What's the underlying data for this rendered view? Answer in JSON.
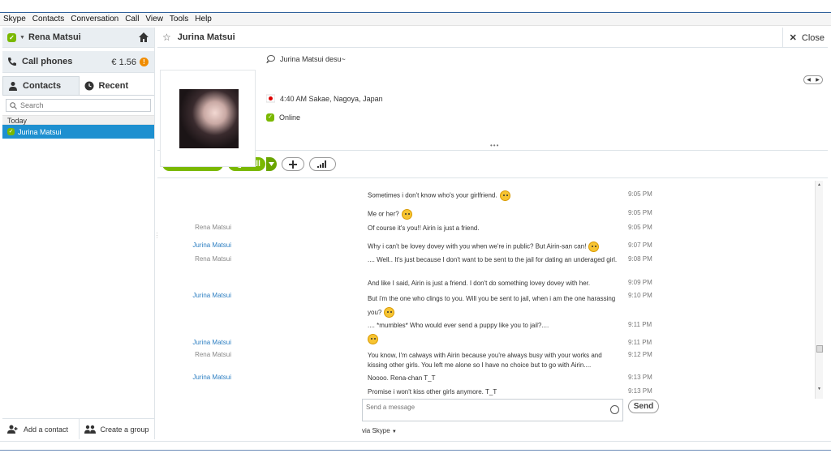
{
  "menu": [
    "Skype",
    "Contacts",
    "Conversation",
    "Call",
    "View",
    "Tools",
    "Help"
  ],
  "sidebar": {
    "profile_name": "Rena Matsui",
    "call_phones_label": "Call phones",
    "credit": "€ 1.56",
    "credit_badge": "!",
    "tabs": [
      "Contacts",
      "Recent"
    ],
    "search_placeholder": "Search",
    "group_label": "Today",
    "contacts": [
      "Jurina Matsui"
    ],
    "footer": {
      "add_contact": "Add a contact",
      "create_group": "Create a group"
    }
  },
  "conversation": {
    "title": "Jurina Matsui",
    "close_label": "Close",
    "mood": "Jurina Matsui desu~",
    "location": "4:40 AM Sakae, Nagoya, Japan",
    "status": "Online",
    "buttons": {
      "video_call": "Video call",
      "call": "Call"
    },
    "compose_placeholder": "Send a message",
    "send_label": "Send",
    "via": "via Skype"
  },
  "messages": [
    {
      "sender": "",
      "text": "Sometimes i don't know who's your girlfriend.",
      "time": "9:05 PM",
      "emoji": true
    },
    {
      "sender": "",
      "text": "Me or her?",
      "time": "9:05 PM",
      "emoji": true
    },
    {
      "sender": "Rena Matsui",
      "text": "Of course it's you!! Airin is just a friend.",
      "time": "9:05 PM",
      "emoji": false
    },
    {
      "sender": "Jurina Matsui",
      "text": "Why i can't be lovey dovey with you when we're in public? But Airin-san can!",
      "time": "9:07 PM",
      "emoji": true
    },
    {
      "sender": "Rena Matsui",
      "text": ".... Well.. It's just because I don't want to be sent to the jail for dating an underaged girl.",
      "time": "9:08 PM",
      "emoji": false
    },
    {
      "sender": "",
      "text": "And like I said, Airin is just a friend. I don't do something lovey dovey with her.",
      "time": "9:09 PM",
      "emoji": false
    },
    {
      "sender": "Jurina Matsui",
      "text": "But i'm the one who clings to you. Will you be sent to jail, when i am the one harassing you?",
      "time": "9:10 PM",
      "emoji": true
    },
    {
      "sender": "",
      "text": ".... *mumbles* Who would ever send a puppy like you to jail?....",
      "time": "9:11 PM",
      "emoji": false
    },
    {
      "sender": "Jurina Matsui",
      "text": "",
      "time": "9:11 PM",
      "emoji": true
    },
    {
      "sender": "Rena Matsui",
      "text": "You know, I'm calways with Airin because you're always busy with your works and kissing other girls. You left me alone so I have no choice but to go with Airin....",
      "time": "9:12 PM",
      "emoji": false
    },
    {
      "sender": "Jurina Matsui",
      "text": "Noooo. Rena-chan T_T",
      "time": "9:13 PM",
      "emoji": false
    },
    {
      "sender": "",
      "text": "Promise i won't kiss other girls anymore. T_T",
      "time": "9:13 PM",
      "emoji": false
    }
  ],
  "colors": {
    "accent_green": "#7ab800",
    "selection_blue": "#1e90d0",
    "peer_name_blue": "#2d7fc2"
  }
}
